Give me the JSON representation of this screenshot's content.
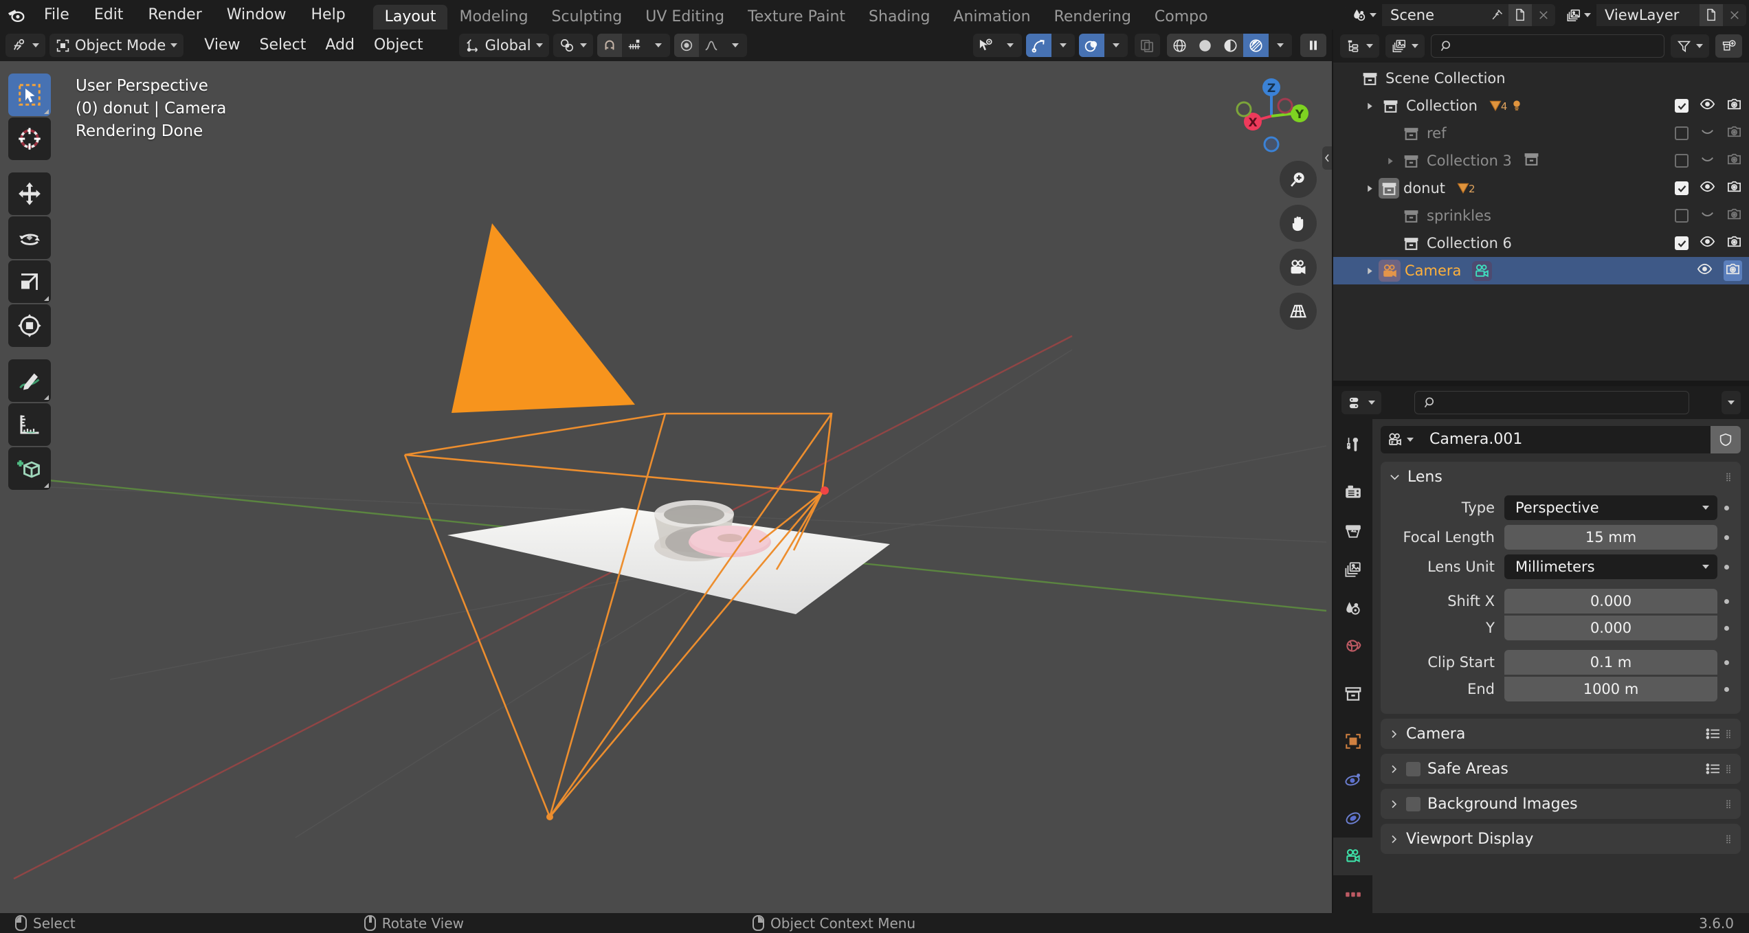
{
  "app": {
    "name": "Blender",
    "version": "3.6.0"
  },
  "topbar": {
    "menus": [
      "File",
      "Edit",
      "Render",
      "Window",
      "Help"
    ],
    "workspace_tabs": [
      {
        "label": "Layout",
        "active": true
      },
      {
        "label": "Modeling",
        "active": false
      },
      {
        "label": "Sculpting",
        "active": false
      },
      {
        "label": "UV Editing",
        "active": false
      },
      {
        "label": "Texture Paint",
        "active": false
      },
      {
        "label": "Shading",
        "active": false
      },
      {
        "label": "Animation",
        "active": false
      },
      {
        "label": "Rendering",
        "active": false
      },
      {
        "label": "Compo",
        "active": false
      }
    ],
    "scene": {
      "label": "Scene",
      "icon": "scene-icon"
    },
    "view_layer": {
      "label": "ViewLayer",
      "icon": "viewlayer-icon"
    }
  },
  "viewport_header": {
    "editor_type_icon": "editor-type-3dview-icon",
    "mode": "Object Mode",
    "menus": [
      "View",
      "Select",
      "Add",
      "Object"
    ],
    "transform_orientation": "Global",
    "pivot_icon": "pivot-point-icon",
    "snap_magnet_icon": "snap-magnet-icon",
    "snap_target_icon": "snap-increment-icon",
    "proportional_edit_icon": "proportional-edit-icon",
    "proportional_falloff_icon": "falloff-smooth-icon",
    "visibility_icon": "object-visibility-icon",
    "gizmo_icon": "gizmo-icon",
    "overlays_icon": "overlays-icon",
    "xray_icon": "xray-toggle-icon",
    "shading_modes": [
      "wireframe",
      "solid",
      "material-preview",
      "rendered"
    ],
    "shading_active_index": 3,
    "pause_icon": "pause-render-icon"
  },
  "viewport": {
    "overlay_lines": [
      "User Perspective",
      "(0) donut | Camera",
      "Rendering Done"
    ],
    "gizmo_axes": [
      {
        "label": "Z",
        "color": "#3b82d6"
      },
      {
        "label": "X",
        "color": "#ee3a5b"
      },
      {
        "label": "Y",
        "color": "#7ed321"
      }
    ],
    "nav_buttons": [
      "zoom-icon",
      "pan-hand-icon",
      "camera-view-icon",
      "toggle-perspective-icon"
    ],
    "tools": [
      {
        "name": "tweak-select-box-tool",
        "active": true,
        "has_submenu": true
      },
      {
        "name": "cursor-tool",
        "active": false,
        "has_submenu": false
      },
      {
        "name": "move-tool",
        "active": false,
        "has_submenu": false
      },
      {
        "name": "rotate-tool",
        "active": false,
        "has_submenu": false
      },
      {
        "name": "scale-tool",
        "active": false,
        "has_submenu": true
      },
      {
        "name": "transform-tool",
        "active": false,
        "has_submenu": false
      },
      {
        "name": "annotate-tool",
        "active": false,
        "has_submenu": true
      },
      {
        "name": "measure-tool",
        "active": false,
        "has_submenu": false
      },
      {
        "name": "add-cube-tool",
        "active": false,
        "has_submenu": true
      }
    ],
    "scene_objects": {
      "light_cone_color": "#f7941d",
      "camera_wire_color": "#ed8e2e",
      "plane_color": "#f0f0ee",
      "donut_color": "#e8b4bc"
    }
  },
  "outliner": {
    "header": {
      "display_mode_icon": "outliner-display-mode-icon",
      "filter_id_icon": "filter-id-type-icon",
      "search_placeholder": "",
      "filter_icon": "filter-funnel-icon",
      "new_collection_icon": "new-collection-icon"
    },
    "rows": [
      {
        "label": "Scene Collection",
        "icon": "collection-icon",
        "indent": 0,
        "disclosure": false,
        "muted": false,
        "selected": false,
        "badges": [],
        "show_controls": false,
        "checkbox": null,
        "eye": null,
        "camera": null
      },
      {
        "label": "Collection",
        "icon": "collection-icon",
        "indent": 1,
        "disclosure": true,
        "muted": false,
        "selected": false,
        "badges": [
          {
            "type": "mesh",
            "count": "4"
          },
          {
            "type": "light",
            "count": ""
          }
        ],
        "show_controls": true,
        "checkbox": "checked",
        "eye": "visible",
        "camera": "enabled"
      },
      {
        "label": "ref",
        "icon": "collection-icon",
        "indent": 2,
        "disclosure": false,
        "muted": true,
        "selected": false,
        "badges": [],
        "show_controls": true,
        "checkbox": "unchecked",
        "eye": "hidden",
        "camera": "disabled"
      },
      {
        "label": "Collection 3",
        "icon": "collection-icon",
        "indent": 2,
        "disclosure": true,
        "muted": true,
        "selected": false,
        "badges": [
          {
            "type": "collection",
            "count": ""
          }
        ],
        "show_controls": true,
        "checkbox": "unchecked",
        "eye": "hidden",
        "camera": "disabled"
      },
      {
        "label": "donut",
        "icon": "collection-icon-active",
        "indent": 1,
        "disclosure": true,
        "muted": false,
        "selected": false,
        "badges": [
          {
            "type": "mesh",
            "count": "2"
          }
        ],
        "show_controls": true,
        "checkbox": "checked",
        "eye": "visible",
        "camera": "enabled"
      },
      {
        "label": "sprinkles",
        "icon": "collection-icon",
        "indent": 2,
        "disclosure": false,
        "muted": true,
        "selected": false,
        "badges": [],
        "show_controls": true,
        "checkbox": "unchecked",
        "eye": "hidden",
        "camera": "disabled"
      },
      {
        "label": "Collection 6",
        "icon": "collection-icon",
        "indent": 2,
        "disclosure": false,
        "muted": false,
        "selected": false,
        "badges": [],
        "show_controls": true,
        "checkbox": "checked",
        "eye": "visible",
        "camera": "enabled"
      },
      {
        "label": "Camera",
        "icon": "camera-object-icon",
        "indent": 1,
        "disclosure": true,
        "muted": false,
        "selected": true,
        "badges": [
          {
            "type": "camera-data",
            "count": ""
          }
        ],
        "show_controls": true,
        "checkbox": null,
        "eye": "visible",
        "camera": "enabled"
      }
    ]
  },
  "properties": {
    "header": {
      "editor_icon": "properties-editor-icon",
      "search_placeholder": "",
      "options_chevron_icon": "chevron-down-icon"
    },
    "tabs": [
      {
        "name": "tool-tab",
        "icon": "tool-screwdriver-wrench-icon",
        "active": false
      },
      {
        "name": "render-tab",
        "icon": "render-camera-back-icon",
        "active": false
      },
      {
        "name": "output-tab",
        "icon": "output-printer-icon",
        "active": false
      },
      {
        "name": "view-layer-tab",
        "icon": "view-layer-images-icon",
        "active": false
      },
      {
        "name": "scene-tab",
        "icon": "scene-cone-sphere-icon",
        "active": false
      },
      {
        "name": "world-tab",
        "icon": "world-globe-icon",
        "active": false
      },
      {
        "name": "collection-tab",
        "icon": "collection-box-icon",
        "active": false
      },
      {
        "name": "object-tab",
        "icon": "object-orange-square-icon",
        "active": false
      },
      {
        "name": "modifiers-tab",
        "icon": "physics-orbit-icon",
        "active": false
      },
      {
        "name": "constraints-tab",
        "icon": "constraints-icon",
        "active": false
      },
      {
        "name": "object-data-tab",
        "icon": "camera-data-green-icon",
        "active": true
      },
      {
        "name": "texture-tab",
        "icon": "texture-checker-icon",
        "active": false
      }
    ],
    "id_block": {
      "icon": "camera-data-icon",
      "name": "Camera.001",
      "fake_user_icon": "shield-icon"
    },
    "lens_panel": {
      "title": "Lens",
      "open": true,
      "rows": [
        {
          "label": "Type",
          "value": "Perspective",
          "widget": "dropdown"
        },
        {
          "label": "Focal Length",
          "value": "15 mm",
          "widget": "number"
        },
        {
          "label": "Lens Unit",
          "value": "Millimeters",
          "widget": "dropdown"
        },
        {
          "label": "Shift X",
          "value": "0.000",
          "widget": "number-stack-top"
        },
        {
          "label": "Y",
          "value": "0.000",
          "widget": "number-stack-bot"
        },
        {
          "label": "Clip Start",
          "value": "0.1 m",
          "widget": "number-stack-top"
        },
        {
          "label": "End",
          "value": "1000 m",
          "widget": "number-stack-bot"
        }
      ]
    },
    "collapsed_panels": [
      {
        "title": "Camera",
        "has_checkbox": false,
        "has_list_icon": true
      },
      {
        "title": "Safe Areas",
        "has_checkbox": true,
        "has_list_icon": true
      },
      {
        "title": "Background Images",
        "has_checkbox": true,
        "has_list_icon": false
      },
      {
        "title": "Viewport Display",
        "has_checkbox": false,
        "has_list_icon": false
      }
    ]
  },
  "statusbar": {
    "items": [
      {
        "mouse": "left",
        "label": "Select"
      },
      {
        "mouse": "middle",
        "label": "Rotate View"
      },
      {
        "mouse": "right",
        "label": "Object Context Menu"
      }
    ],
    "version": "3.6.0"
  }
}
